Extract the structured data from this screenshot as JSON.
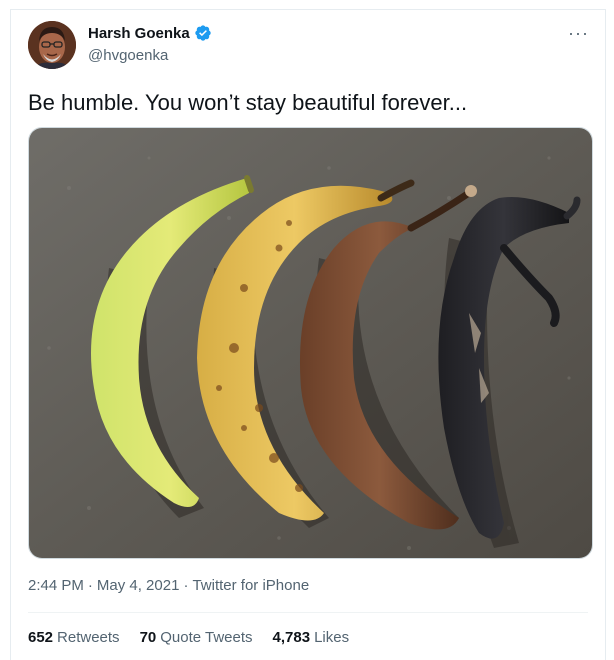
{
  "author": {
    "display_name": "Harsh Goenka",
    "handle": "@hvgoenka",
    "verified_icon": "verified-badge-icon",
    "verified_color": "#1d9bf0"
  },
  "more_icon": "···",
  "tweet": {
    "text": "Be humble. You won’t stay beautiful forever..."
  },
  "meta": {
    "time": "2:44 PM",
    "sep1": "·",
    "date": "May 4, 2021",
    "sep2": "·",
    "source": "Twitter for iPhone"
  },
  "stats": {
    "retweets_count": "652",
    "retweets_label": "Retweets",
    "quotes_count": "70",
    "quotes_label": "Quote Tweets",
    "likes_count": "4,783",
    "likes_label": "Likes"
  }
}
